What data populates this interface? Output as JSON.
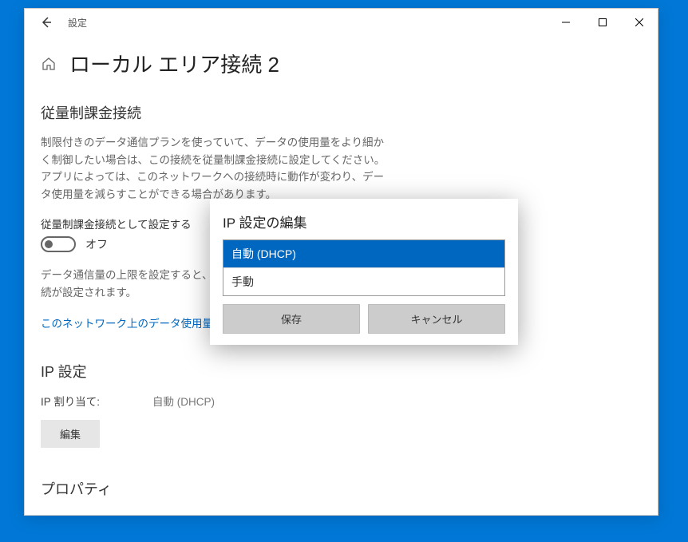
{
  "titlebar": {
    "title": "設定"
  },
  "page": {
    "title": "ローカル エリア接続 2"
  },
  "metered": {
    "section_title": "従量制課金接続",
    "description": "制限付きのデータ通信プランを使っていて、データの使用量をより細かく制御したい場合は、この接続を従量制課金接続に設定してください。アプリによっては、このネットワークへの接続時に動作が変わり、データ使用量を減らすことができる場合があります。",
    "toggle_label": "従量制課金接続として設定する",
    "toggle_state": "オフ",
    "data_limit_desc": "データ通信量の上限を設定すると、上限を超えないように従量制課金接続が設定されます。",
    "link_text": "このネットワーク上のデータ使用量を制御するためのデータ通信量上限を設定する"
  },
  "ip": {
    "section_title": "IP 設定",
    "assign_label": "IP 割り当て:",
    "assign_value": "自動 (DHCP)",
    "edit_button": "編集"
  },
  "properties": {
    "section_title": "プロパティ"
  },
  "dialog": {
    "title": "IP 設定の編集",
    "option_auto": "自動 (DHCP)",
    "option_manual": "手動",
    "save": "保存",
    "cancel": "キャンセル"
  }
}
